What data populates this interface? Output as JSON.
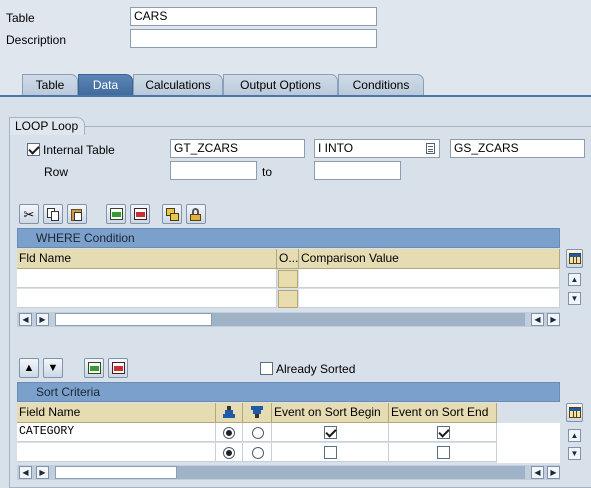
{
  "header": {
    "table_label": "Table",
    "table_value": "CARS",
    "description_label": "Description",
    "description_value": ""
  },
  "tabs": [
    {
      "label": "Table",
      "active": false
    },
    {
      "label": "Data",
      "active": true
    },
    {
      "label": "Calculations",
      "active": false
    },
    {
      "label": "Output Options",
      "active": false
    },
    {
      "label": "Conditions",
      "active": false
    }
  ],
  "loop": {
    "group_title": "LOOP Loop",
    "internal_table_label": "Internal Table",
    "internal_table_checked": true,
    "internal_table_value": "GT_ZCARS",
    "into_value": "I INTO",
    "target_value": "GS_ZCARS",
    "row_label": "Row",
    "row_from": "",
    "to_label": "to",
    "row_to": ""
  },
  "where": {
    "title": "WHERE Condition",
    "columns": [
      "Fld Name",
      "O...",
      "Comparison Value"
    ],
    "rows": [
      [
        "",
        "",
        ""
      ],
      [
        "",
        "",
        ""
      ]
    ]
  },
  "sort": {
    "already_sorted_label": "Already Sorted",
    "already_sorted_checked": false,
    "title": "Sort Criteria",
    "columns": [
      "Field Name",
      "",
      "",
      "Event on Sort Begin",
      "Event on Sort End"
    ],
    "rows": [
      {
        "field": "CATEGORY",
        "ascending": true,
        "begin": true,
        "end": true
      },
      {
        "field": "",
        "ascending": true,
        "begin": false,
        "end": false
      }
    ]
  },
  "icons": [
    "cut-icon",
    "copy-icon",
    "paste-icon",
    "insert-row-icon",
    "delete-row-icon",
    "copy-rows-icon",
    "lock-icon",
    "move-up-icon",
    "move-down-icon",
    "sort-ascending-icon",
    "sort-descending-icon",
    "column-settings-icon",
    "value-help-icon"
  ]
}
